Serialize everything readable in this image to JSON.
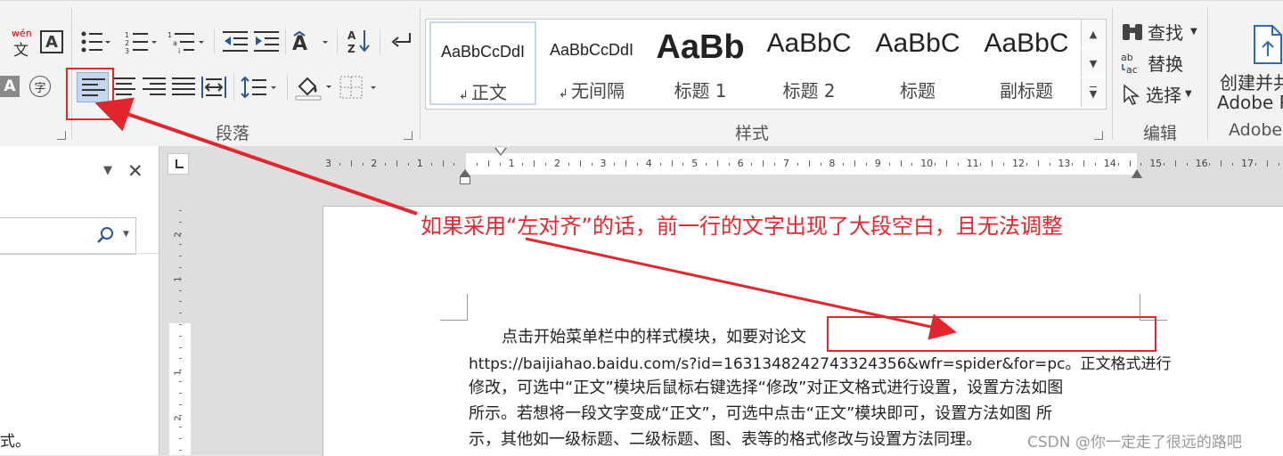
{
  "ribbon": {
    "groups": {
      "paragraph": "段落",
      "styles": "样式",
      "editing": "编辑",
      "adobe": "Adobe"
    },
    "font_tools": {
      "phonetic_top": "wén",
      "phonetic_bottom": "文",
      "char_border": "A",
      "shading": "A",
      "enclose": "字"
    },
    "styles": [
      {
        "sample": "AaBbCcDdI",
        "name": "正文",
        "marker": "↲",
        "selected": true
      },
      {
        "sample": "AaBbCcDdI",
        "name": "无间隔",
        "marker": "↲",
        "selected": false
      },
      {
        "sample": "AaBb",
        "name": "标题 1",
        "marker": "",
        "selected": false
      },
      {
        "sample": "AaBbC",
        "name": "标题 2",
        "marker": "",
        "selected": false
      },
      {
        "sample": "AaBbC",
        "name": "标题",
        "marker": "",
        "selected": false
      },
      {
        "sample": "AaBbC",
        "name": "副标题",
        "marker": "",
        "selected": false
      }
    ],
    "editing": {
      "find": "查找",
      "replace": "替换",
      "select": "选择"
    },
    "adobe": {
      "create_line1": "创建并共",
      "create_line2": "Adobe P"
    }
  },
  "ruler": {
    "labels": [
      "3",
      "2",
      "1",
      "",
      "1",
      "2",
      "3",
      "4",
      "5",
      "6",
      "7",
      "8",
      "9",
      "10",
      "11",
      "12",
      "13",
      "14",
      "15",
      "16",
      "17"
    ],
    "vertical_labels": [
      "2",
      "1",
      "1",
      "2"
    ]
  },
  "navpane": {
    "close": "✕",
    "bottom_text": "式。"
  },
  "annotation": "如果采用“左对齐”的话，前一行的文字出现了大段空白，且无法调整",
  "document": {
    "lines": [
      "点击开始菜单栏中的样式模块，如要对论文",
      "https://baijiahao.baidu.com/s?id=1631348242743324356&wfr=spider&for=pc。正文格式进行",
      "修改，可选中“正文”模块后鼠标右键选择“修改”对正文格式进行设置，设置方法如图",
      "所示。若想将一段文字变成“正文”，可选中点击“正文”模块即可，设置方法如图  所",
      "示，其他如一级标题、二级标题、图、表等的格式修改与设置方法同理。"
    ]
  },
  "watermark": "CSDN @你一定走了很远的路吧",
  "colors": {
    "annotation_red": "#e3262d",
    "selected_button": "#c5d7ee",
    "ribbon_bg": "#f3f3f3"
  }
}
